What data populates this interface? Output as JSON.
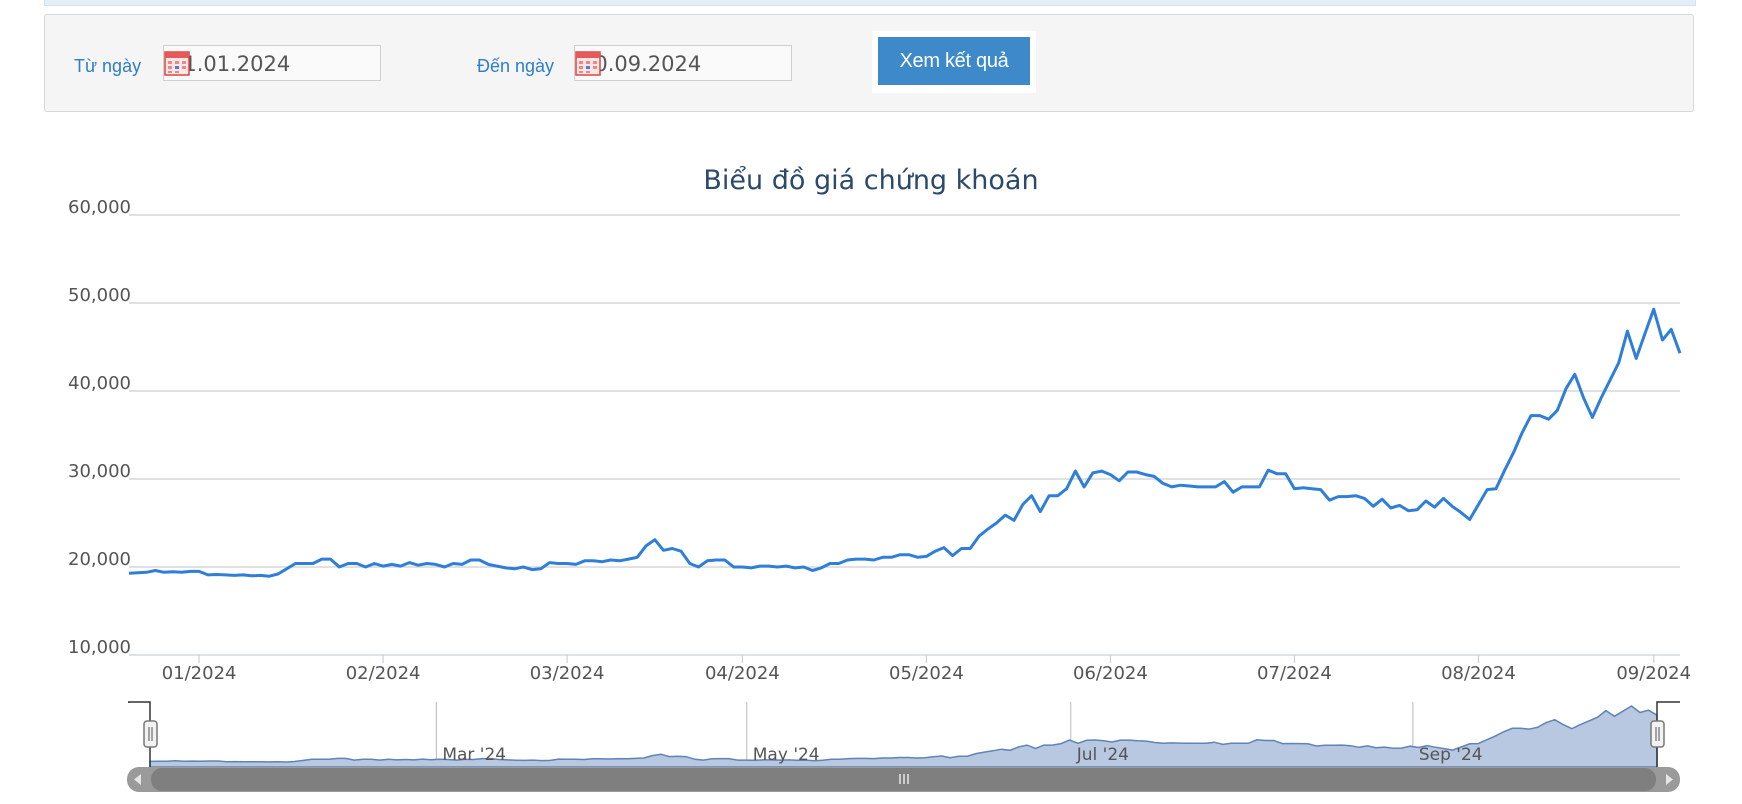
{
  "filter": {
    "from_label": "Từ ngày",
    "from_value": "01.01.2024",
    "to_label": "Đến ngày",
    "to_value": "20.09.2024",
    "submit_label": "Xem kết quả"
  },
  "navigator": {
    "labels": [
      "Mar '24",
      "May '24",
      "Jul '24",
      "Sep '24"
    ]
  },
  "colors": {
    "line": "#2f7ed8",
    "accent": "#3d89ca",
    "label": "#2f7ec8"
  },
  "chart_data": {
    "type": "line",
    "title": "Biểu đồ giá chứng khoán",
    "xlabel": "",
    "ylabel": "",
    "ylim": [
      10000,
      60000
    ],
    "yticks": [
      10000,
      20000,
      30000,
      40000,
      50000,
      60000
    ],
    "ytick_labels": [
      "10,000",
      "20,000",
      "30,000",
      "40,000",
      "50,000",
      "60,000"
    ],
    "xtick_labels": [
      "01/2024",
      "02/2024",
      "03/2024",
      "04/2024",
      "05/2024",
      "06/2024",
      "07/2024",
      "08/2024",
      "09/2024"
    ],
    "grid": true,
    "legend": "none",
    "series": [
      {
        "values": [
          19300,
          19350,
          19400,
          19600,
          19400,
          19450,
          19400,
          19500,
          19500,
          19100,
          19150,
          19100,
          19050,
          19100,
          19000,
          19050,
          18950,
          19200,
          19800,
          20400,
          20400,
          20400,
          20900,
          20900,
          20000,
          20400,
          20400,
          20000,
          20400,
          20100,
          20300,
          20100,
          20500,
          20200,
          20400,
          20300,
          20000,
          20400,
          20300,
          20800,
          20800,
          20300,
          20100,
          19900,
          19800,
          20000,
          19700,
          19800,
          20500,
          20400,
          20400,
          20300,
          20700,
          20700,
          20600,
          20800,
          20700,
          20900,
          21100,
          22400,
          23100,
          21900,
          22100,
          21800,
          20400,
          20000,
          20700,
          20800,
          20800,
          20000,
          20000,
          19900,
          20100,
          20100,
          20000,
          20100,
          19900,
          20000,
          19600,
          19900,
          20400,
          20400,
          20800,
          20900,
          20900,
          20800,
          21100,
          21100,
          21400,
          21400,
          21100,
          21200,
          21800,
          22200,
          21300,
          22100,
          22100,
          23500,
          24300,
          25000,
          25900,
          25300,
          27100,
          28100,
          26300,
          28100,
          28100,
          28900,
          30900,
          29100,
          30700,
          30900,
          30500,
          29800,
          30800,
          30800,
          30500,
          30300,
          29500,
          29100,
          29300,
          29200,
          29100,
          29100,
          29100,
          29700,
          28500,
          29100,
          29100,
          29100,
          31000,
          30600,
          30600,
          28900,
          29000,
          28900,
          28800,
          27600,
          28000,
          28000,
          28100,
          27800,
          26900,
          27700,
          26700,
          27000,
          26400,
          26500,
          27500,
          26800,
          27800,
          26900,
          26200,
          25400,
          27100,
          28800,
          28900,
          31000,
          33000,
          35300,
          37200,
          37200,
          36800,
          37800,
          40300,
          41900,
          39200,
          37000,
          39200,
          41200,
          43200,
          46800,
          43700,
          46500,
          49300,
          45800,
          47000,
          44300
        ]
      }
    ]
  }
}
